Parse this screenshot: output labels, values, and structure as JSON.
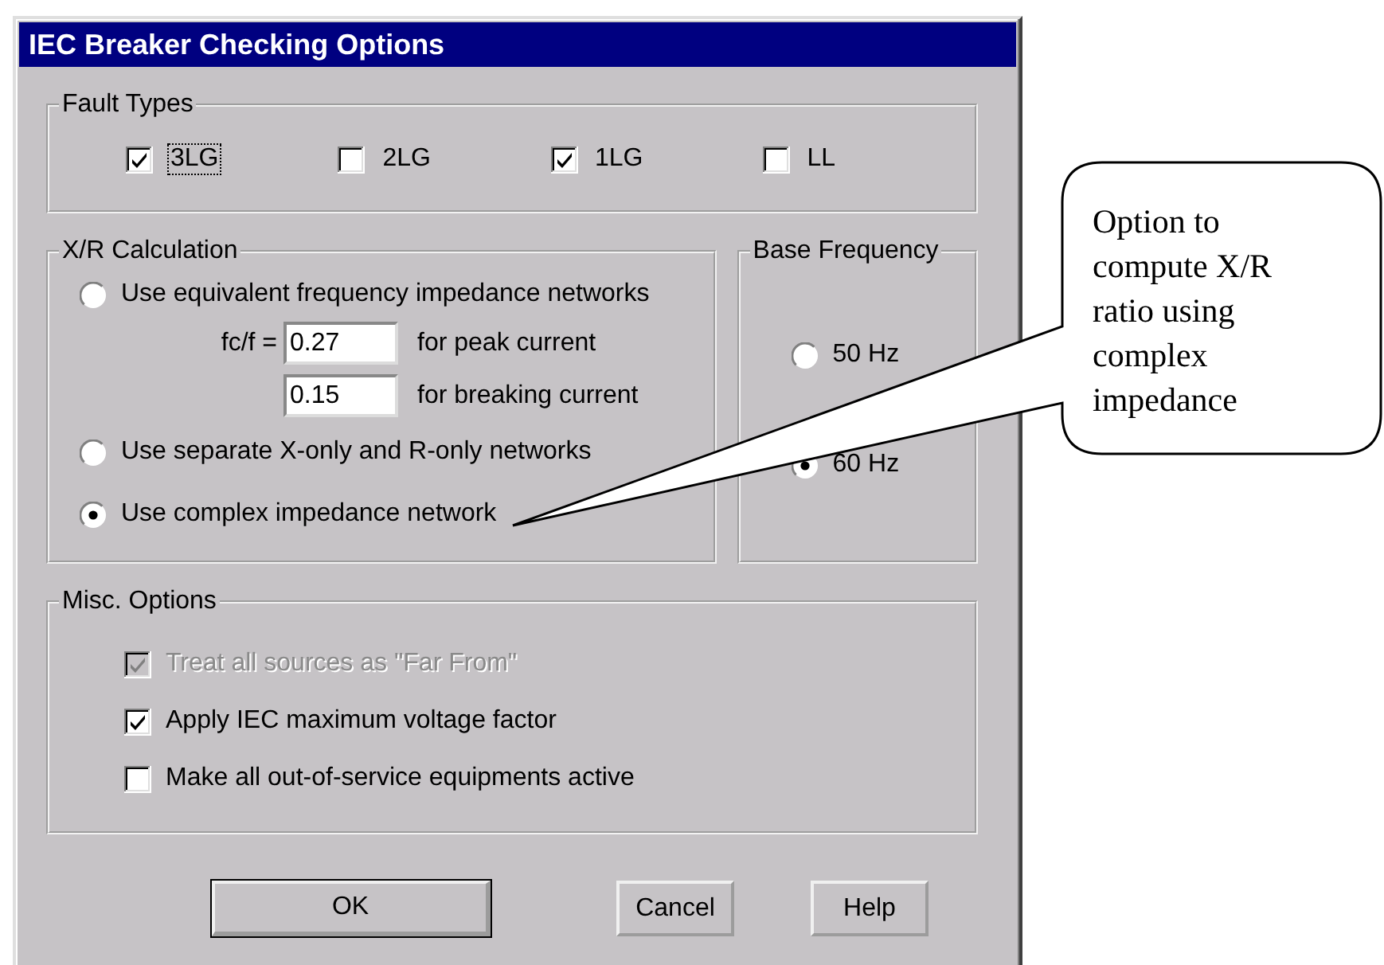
{
  "window": {
    "title": "IEC Breaker Checking Options"
  },
  "fault_types": {
    "label": "Fault Types",
    "items": [
      {
        "label": "3LG",
        "checked": true,
        "focused": true
      },
      {
        "label": "2LG",
        "checked": false,
        "focused": false
      },
      {
        "label": "1LG",
        "checked": true,
        "focused": false
      },
      {
        "label": "LL",
        "checked": false,
        "focused": false
      }
    ]
  },
  "xr_calculation": {
    "label": "X/R Calculation",
    "options": [
      {
        "label": "Use equivalent frequency impedance networks",
        "selected": false
      },
      {
        "label": "Use separate X-only and R-only networks",
        "selected": false
      },
      {
        "label": "Use complex impedance network",
        "selected": true
      }
    ],
    "fc_label": "fc/f =",
    "fields": [
      {
        "value": "0.27",
        "caption": "for peak current"
      },
      {
        "value": "0.15",
        "caption": "for breaking current"
      }
    ]
  },
  "base_frequency": {
    "label": "Base Frequency",
    "options": [
      {
        "label": "50 Hz",
        "selected": false
      },
      {
        "label": "60 Hz",
        "selected": true
      }
    ]
  },
  "misc_options": {
    "label": "Misc. Options",
    "items": [
      {
        "label": "Treat all sources as \"Far From\"",
        "checked": true,
        "disabled": true
      },
      {
        "label": "Apply IEC maximum voltage factor",
        "checked": true,
        "disabled": false
      },
      {
        "label": "Make all out-of-service equipments active",
        "checked": false,
        "disabled": false
      }
    ]
  },
  "buttons": [
    {
      "label": "OK",
      "default": true
    },
    {
      "label": "Cancel",
      "default": false
    },
    {
      "label": "Help",
      "default": false
    }
  ],
  "callout": {
    "text": "Option to compute X/R ratio using complex impedance"
  }
}
